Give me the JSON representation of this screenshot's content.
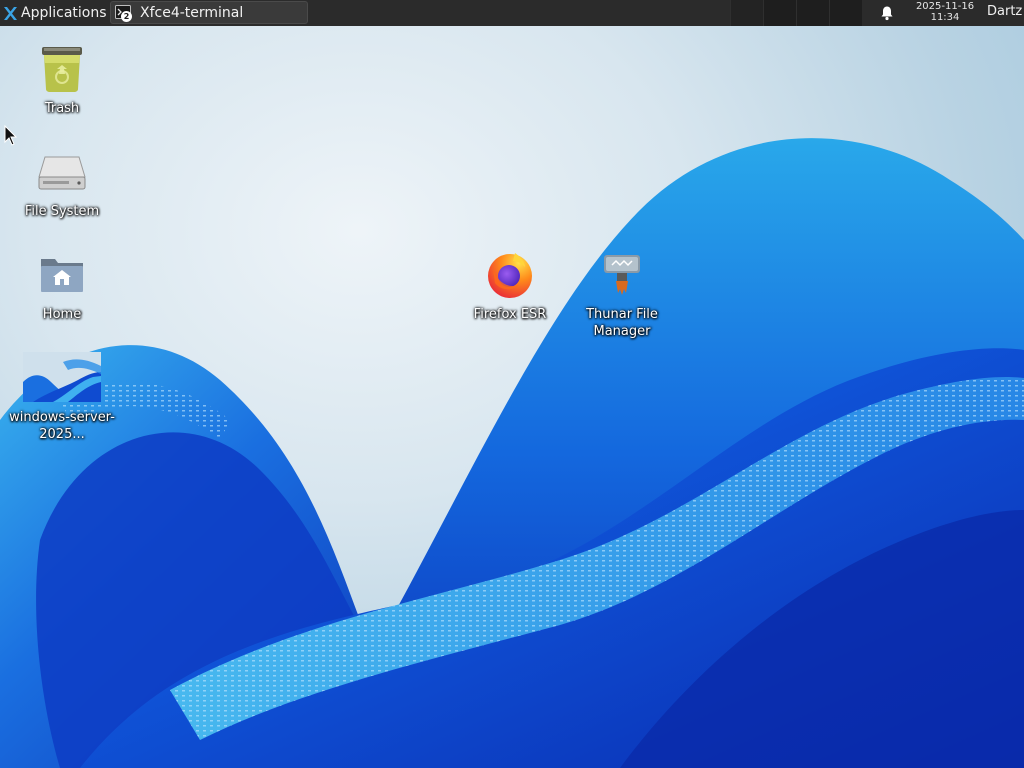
{
  "panel": {
    "applications_label": "Applications",
    "task": {
      "label": "Xfce4-terminal",
      "badge": "2"
    },
    "clock": {
      "date": "2025-11-16",
      "time": "11:34"
    },
    "user": "Dartz",
    "workspaces": [
      "ws1",
      "ws2",
      "ws3",
      "ws4"
    ]
  },
  "desktop": {
    "icons": [
      {
        "name": "Trash",
        "icon": "trash-icon"
      },
      {
        "name": "File System",
        "icon": "drive-icon"
      },
      {
        "name": "Home",
        "icon": "home-folder-icon"
      },
      {
        "name": "windows-server-2025...",
        "icon": "image-thumbnail-icon"
      },
      {
        "name": "Firefox ESR",
        "icon": "firefox-icon"
      },
      {
        "name": "Thunar File Manager",
        "icon": "file-manager-icon"
      }
    ]
  },
  "colors": {
    "panel_bg": "#2b2b2b",
    "wallpaper_light": "#d8e6ef",
    "wallpaper_blue": "#0a3fd0"
  }
}
